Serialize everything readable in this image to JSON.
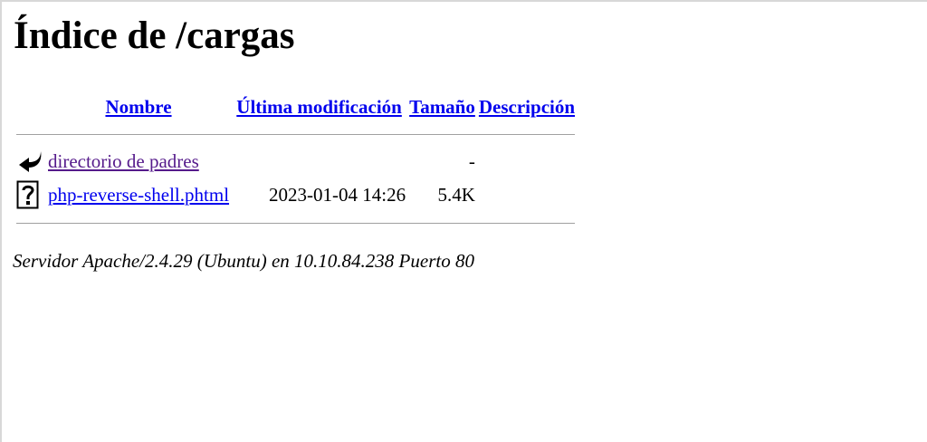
{
  "page": {
    "title": "Índice de /cargas"
  },
  "table": {
    "headers": {
      "name": "Nombre",
      "modified": "Última modificación",
      "size": "Tamaño",
      "description": "Descripción"
    },
    "rows": [
      {
        "icon": "back-arrow-icon",
        "name": "directorio de padres",
        "modified": "",
        "size": "-",
        "description": ""
      },
      {
        "icon": "unknown-file-icon",
        "name": "php-reverse-shell.phtml",
        "modified": "2023-01-04 14:26",
        "size": "5.4K",
        "description": ""
      }
    ]
  },
  "footer": {
    "text": "Servidor Apache/2.4.29 (Ubuntu) en 10.10.84.238 Puerto 80"
  },
  "colors": {
    "link": "#0000ee",
    "visited_link": "#551a8b",
    "rule": "#a0a0a0"
  }
}
